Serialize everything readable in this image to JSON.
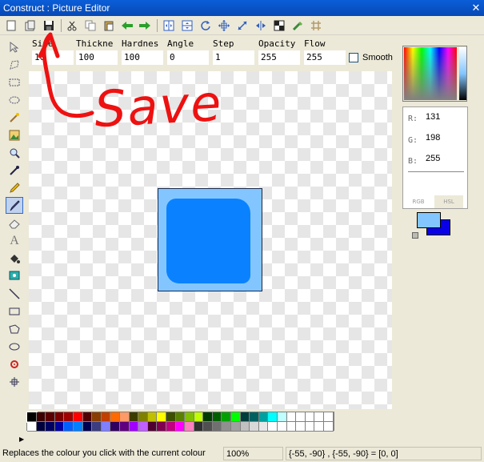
{
  "window": {
    "title": "Construct : Picture Editor",
    "close_glyph": "✕"
  },
  "toolbar": {
    "buttons": [
      "new-icon",
      "open-icon",
      "save-icon",
      "cut-icon",
      "copy-icon",
      "paste-icon",
      "undo-icon",
      "redo-icon",
      "flip-horizontal-icon",
      "flip-vertical-icon",
      "rotate-icon",
      "crop-icon",
      "resize-icon",
      "mirror-icon",
      "mask-icon",
      "effects-icon",
      "grid-icon"
    ]
  },
  "params": {
    "size": {
      "label": "Size",
      "value": "10"
    },
    "thickness": {
      "label": "Thickne",
      "value": "100"
    },
    "hardness": {
      "label": "Hardnes",
      "value": "100"
    },
    "angle": {
      "label": "Angle",
      "value": "0"
    },
    "step": {
      "label": "Step",
      "value": "1"
    },
    "opacity": {
      "label": "Opacity",
      "value": "255"
    },
    "flow": {
      "label": "Flow",
      "value": "255"
    },
    "smooth_label": "Smooth"
  },
  "annotation": {
    "text": "Save",
    "color": "#ee1111"
  },
  "tools": [
    "select-arrow-icon",
    "lasso-icon",
    "rect-select-icon",
    "ellipse-select-icon",
    "magic-wand-icon",
    "image-icon",
    "zoom-icon",
    "eyedropper-icon",
    "pencil-icon",
    "brush-icon",
    "eraser-icon",
    "text-icon",
    "fill-icon",
    "hotspot-icon",
    "line-icon",
    "rectangle-icon",
    "polygon-icon",
    "ellipse-icon",
    "action-point-icon",
    "move-icon"
  ],
  "active_tool": "brush-icon",
  "color": {
    "r_label": "R:",
    "r": "131",
    "g_label": "G:",
    "g": "198",
    "b_label": "B:",
    "b": "255",
    "tab_rgb": "RGB",
    "tab_hsl": "HSL",
    "foreground": "#83c6ff",
    "background": "#0a00e8"
  },
  "palette": [
    "#000000",
    "#3c0000",
    "#5a0000",
    "#7a0000",
    "#a00000",
    "#ff0000",
    "#500000",
    "#8a3d00",
    "#c04000",
    "#ff6a00",
    "#ff9966",
    "#3c3c00",
    "#808000",
    "#c0c000",
    "#ffff00",
    "#3c5000",
    "#5a8000",
    "#80c000",
    "#c0ff00",
    "#003c00",
    "#006000",
    "#00a000",
    "#00ff00",
    "#003c3c",
    "#006060",
    "#00a0a0",
    "#00ffff",
    "#c0ffff",
    "#ffffff",
    "#ffffff",
    "#ffffff",
    "#ffffff",
    "#ffffff",
    "#ffffff",
    "#00003c",
    "#000060",
    "#0000a0",
    "#0060ff",
    "#0080ff",
    "#000050",
    "#3c3c80",
    "#8080ff",
    "#300060",
    "#600080",
    "#a000ff",
    "#c060ff",
    "#500030",
    "#800050",
    "#c00080",
    "#ff00ff",
    "#ff80c0",
    "#303030",
    "#505050",
    "#707070",
    "#909090",
    "#a0a0a0",
    "#c0c0c0",
    "#d8d8d8",
    "#e8e8e8",
    "#ffffff",
    "#ffffff",
    "#ffffff",
    "#ffffff",
    "#ffffff",
    "#ffffff",
    "#ffffff"
  ],
  "status": {
    "message": "Replaces the colour you click with the current colour",
    "zoom": "100%",
    "coords": "{-55, -90} , {-55, -90} = [0, 0]"
  }
}
